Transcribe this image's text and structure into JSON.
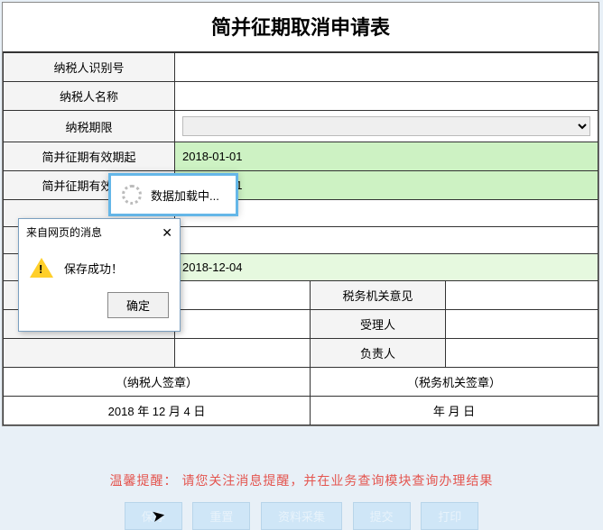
{
  "title": "简并征期取消申请表",
  "rows": {
    "taxpayer_id_label": "纳税人识别号",
    "taxpayer_id_value": "",
    "taxpayer_name_label": "纳税人名称",
    "taxpayer_name_value": "",
    "tax_period_label": "纳税期限",
    "tax_period_value": "",
    "valid_from_label": "简并征期有效期起",
    "valid_from_value": "2018-01-01",
    "valid_to_label": "简并征期有效期止",
    "valid_to_value": "2018-03-31",
    "apply_date_value": "2018-12-04"
  },
  "lower": {
    "tax_opinion": "税务机关意见",
    "accept_person": "受理人",
    "charge_person": "负责人",
    "taxpayer_sign": "（纳税人签章）",
    "tax_sign": "（税务机关签章）",
    "date_left": "2018 年 12 月 4 日",
    "date_right": "年    月    日"
  },
  "footer": {
    "tip_prefix": "温馨提醒：",
    "tip_body": "请您关注消息提醒，并在业务查询模块查询办理结果",
    "buttons": [
      "保存",
      "重置",
      "资料采集",
      "提交",
      "打印"
    ]
  },
  "loading": {
    "text": "数据加载中..."
  },
  "dialog": {
    "title": "来自网页的消息",
    "body": "保存成功！",
    "ok": "确定"
  }
}
